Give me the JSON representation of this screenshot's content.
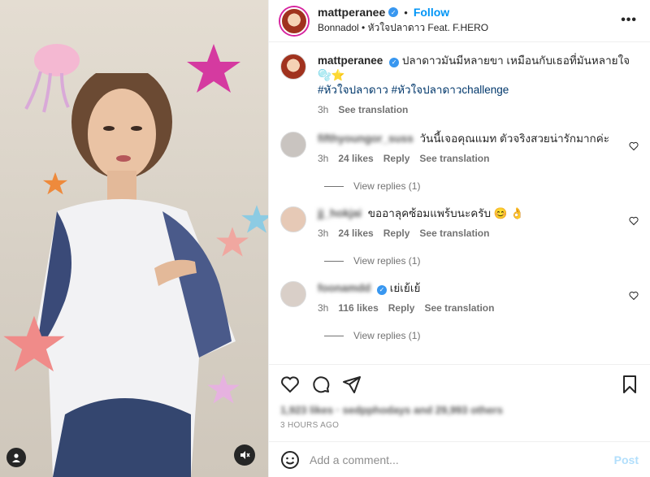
{
  "post": {
    "username": "mattperanee",
    "follow_label": "Follow",
    "song": "Bonnadol • หัวใจปลาดาว Feat. F.HERO",
    "more": "•••"
  },
  "caption": {
    "username": "mattperanee",
    "text": "ปลาดาวมันมีหลายขา เหมือนกับเธอที่มันหลายใจ 🫧⭐",
    "hashtags": "#หัวใจปลาดาว #หัวใจปลาดาวchallenge",
    "time": "3h",
    "see_translation": "See translation"
  },
  "comments": [
    {
      "username": "fifthyoungor_suss",
      "text": "วันนี้เจอคุณแมท ตัวจริงสวยน่ารักมากค่ะ",
      "time": "3h",
      "likes": "24 likes",
      "reply": "Reply",
      "see_translation": "See translation",
      "view_replies": "View replies (1)"
    },
    {
      "username": "jj_hokjai",
      "text": "ขออาลุคซ้อมแพร้บนะครับ 😊 👌",
      "time": "3h",
      "likes": "24 likes",
      "reply": "Reply",
      "see_translation": "See translation",
      "view_replies": "View replies (1)"
    },
    {
      "username": "foonamdd",
      "text": "เย่เย้เย้",
      "time": "3h",
      "likes": "116 likes",
      "reply": "Reply",
      "see_translation": "See translation",
      "view_replies": "View replies (1)"
    }
  ],
  "footer": {
    "likes_text": "1,923 likes · sedpphodays and 29,993 others",
    "timestamp": "3 HOURS AGO",
    "add_comment_placeholder": "Add a comment...",
    "post_label": "Post"
  },
  "colors": {
    "accent": "#0095f6",
    "verified": "#3897f0",
    "hashtag": "#00376b"
  }
}
